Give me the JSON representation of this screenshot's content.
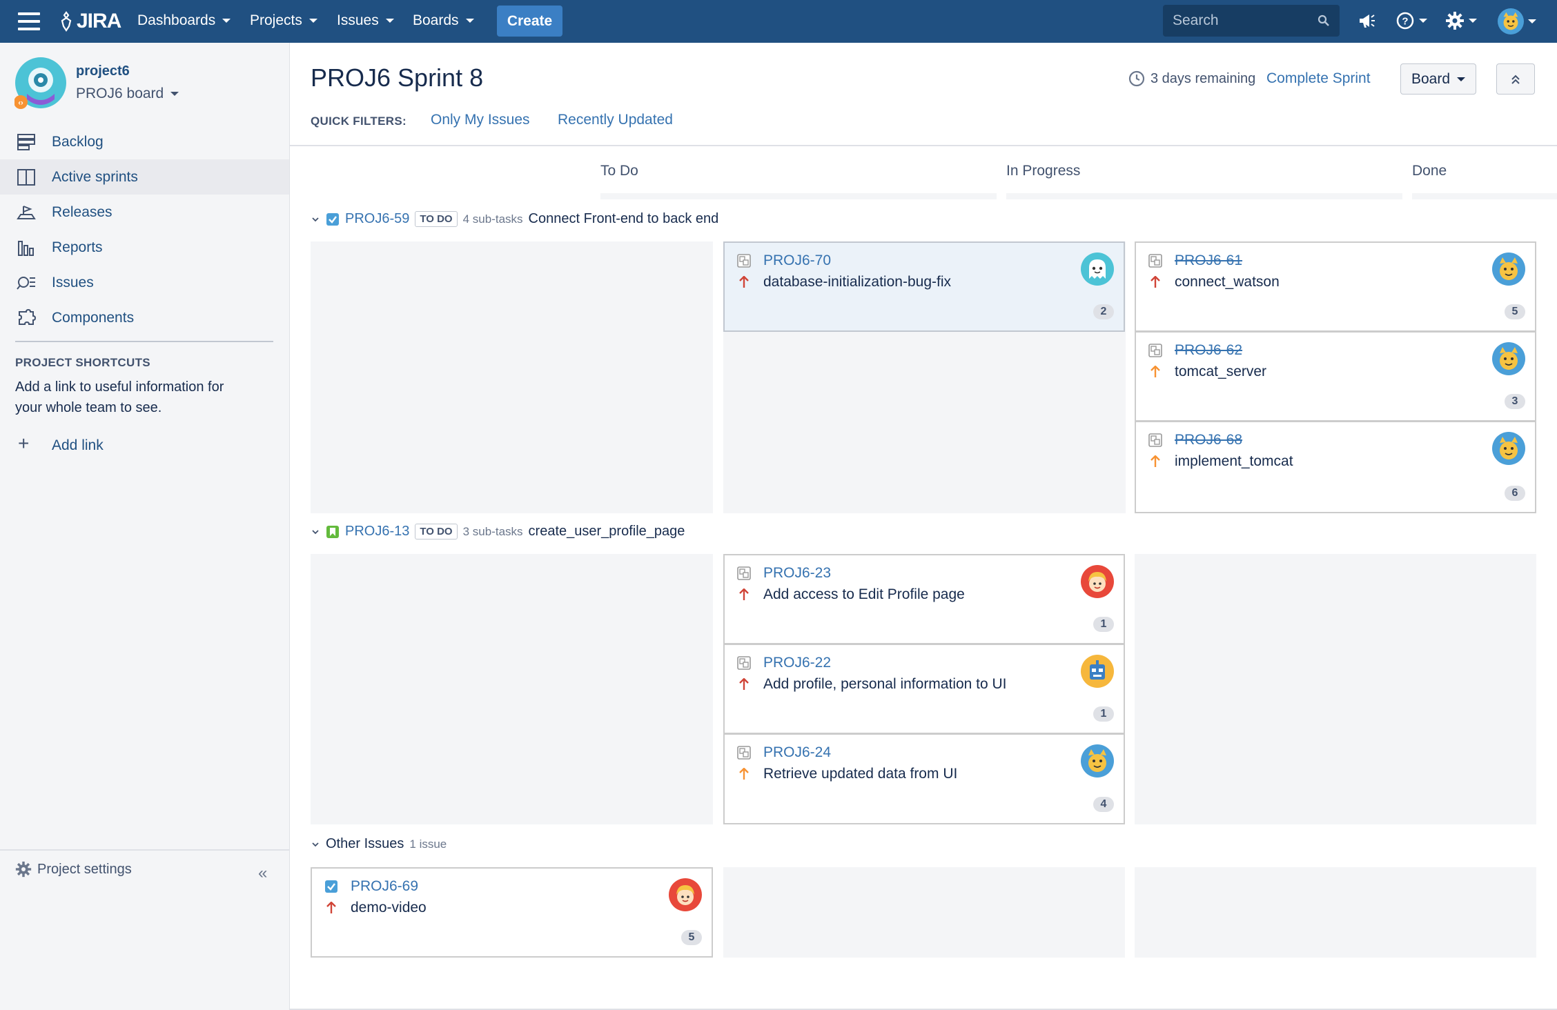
{
  "nav": {
    "logo": "JIRA",
    "items": [
      "Dashboards",
      "Projects",
      "Issues",
      "Boards"
    ],
    "create": "Create",
    "search_placeholder": "Search"
  },
  "sidebar": {
    "project_name": "project6",
    "board_name": "PROJ6 board",
    "items": [
      {
        "label": "Backlog",
        "icon": "backlog-icon"
      },
      {
        "label": "Active sprints",
        "icon": "active-sprints-icon"
      },
      {
        "label": "Releases",
        "icon": "releases-icon"
      },
      {
        "label": "Reports",
        "icon": "reports-icon"
      },
      {
        "label": "Issues",
        "icon": "issues-icon"
      },
      {
        "label": "Components",
        "icon": "components-icon"
      }
    ],
    "shortcuts_title": "PROJECT SHORTCUTS",
    "shortcuts_desc": "Add a link to useful information for your whole team to see.",
    "add_link": "Add link",
    "settings": "Project settings"
  },
  "header": {
    "title": "PROJ6 Sprint 8",
    "remaining": "3 days remaining",
    "complete_sprint": "Complete Sprint",
    "board_button": "Board",
    "quick_filters_label": "QUICK FILTERS:",
    "quick_filters": [
      "Only My Issues",
      "Recently Updated"
    ]
  },
  "columns": [
    "To Do",
    "In Progress",
    "Done"
  ],
  "swimlanes": [
    {
      "key": "PROJ6-59",
      "status": "TO DO",
      "subtasks": "4 sub-tasks",
      "summary": "Connect Front-end to back end",
      "in_progress": [
        {
          "key": "PROJ6-70",
          "summary": "database-initialization-bug-fix",
          "estimate": "2",
          "priority": "high",
          "avatar": "ghost"
        }
      ],
      "done": [
        {
          "key": "PROJ6-61",
          "summary": "connect_watson",
          "estimate": "5",
          "priority": "high",
          "avatar": "cat"
        },
        {
          "key": "PROJ6-62",
          "summary": "tomcat_server",
          "estimate": "3",
          "priority": "medium",
          "avatar": "cat"
        },
        {
          "key": "PROJ6-68",
          "summary": "implement_tomcat",
          "estimate": "6",
          "priority": "medium",
          "avatar": "cat"
        }
      ]
    },
    {
      "key": "PROJ6-13",
      "status": "TO DO",
      "subtasks": "3 sub-tasks",
      "summary": "create_user_profile_page",
      "in_progress": [
        {
          "key": "PROJ6-23",
          "summary": "Add access to Edit Profile page",
          "estimate": "1",
          "priority": "high",
          "avatar": "person"
        },
        {
          "key": "PROJ6-22",
          "summary": "Add profile, personal information to UI",
          "estimate": "1",
          "priority": "high",
          "avatar": "robot"
        },
        {
          "key": "PROJ6-24",
          "summary": "Retrieve updated data from UI",
          "estimate": "4",
          "priority": "medium",
          "avatar": "cat"
        }
      ]
    }
  ],
  "other": {
    "label": "Other Issues",
    "count": "1 issue",
    "card": {
      "key": "PROJ6-69",
      "summary": "demo-video",
      "estimate": "5",
      "priority": "high",
      "avatar": "person"
    }
  },
  "colors": {
    "nav_bg": "#205081",
    "link": "#3572b0",
    "priority_high": "#d04437",
    "priority_medium": "#f79232"
  }
}
